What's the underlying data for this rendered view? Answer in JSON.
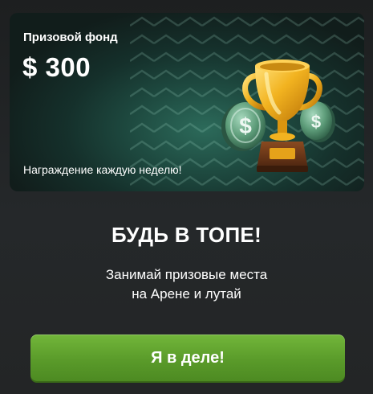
{
  "prize_card": {
    "title": "Призовой фонд",
    "amount": "$ 300",
    "subtitle": "Награждение каждую неделю!",
    "art": [
      "trophy-icon",
      "dollar-coin-icon"
    ]
  },
  "headline": "БУДЬ В ТОПЕ!",
  "description": {
    "line1": "Занимай призовые места",
    "line2": "на Арене и лутай"
  },
  "cta": {
    "label": "Я в деле!"
  },
  "colors": {
    "background": "#232526",
    "card_accent": "#2c6a5a",
    "button_green": "#5a9b2a",
    "trophy_gold": "#f2b320",
    "coin_green": "#5e9d7a"
  }
}
